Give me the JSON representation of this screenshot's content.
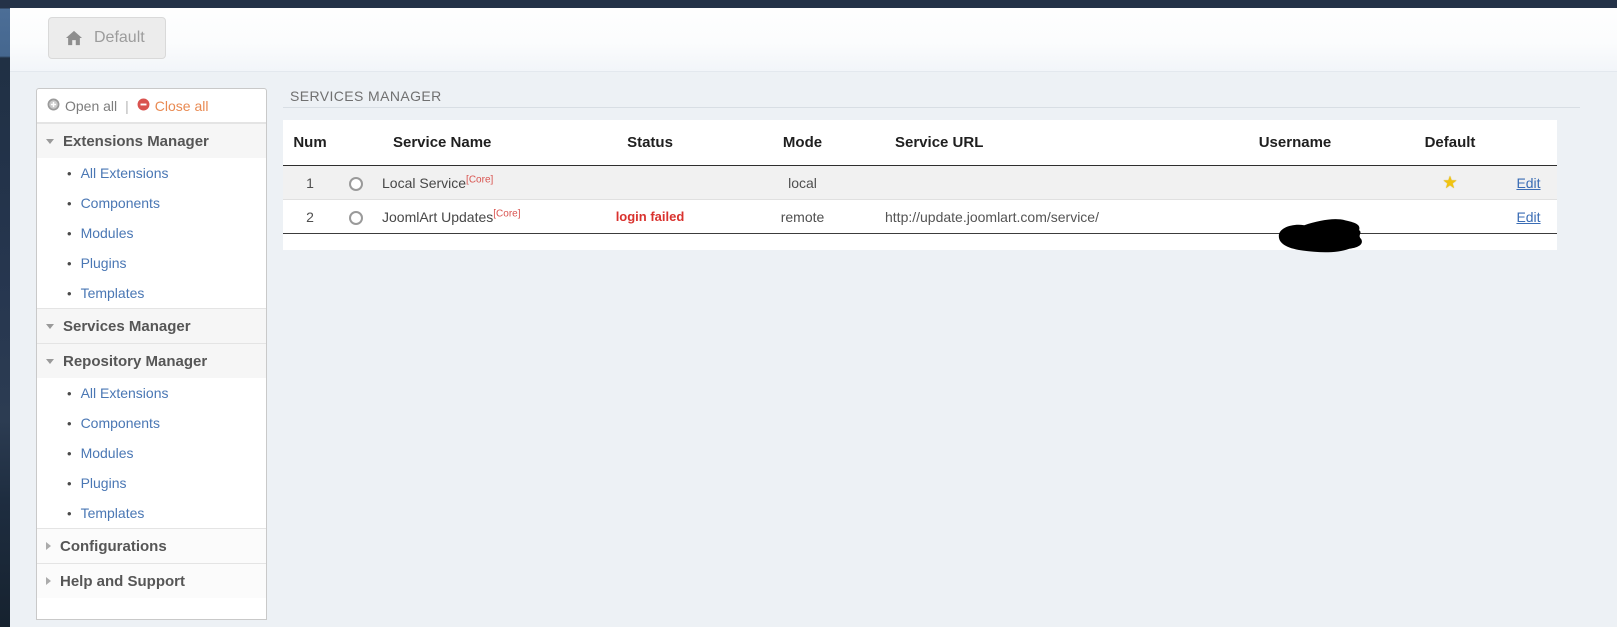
{
  "top_nav": {
    "default_label": "Default"
  },
  "sidebar": {
    "open_all": "Open all",
    "divider": "|",
    "close_all": "Close all",
    "sections": [
      {
        "label": "Extensions Manager",
        "state": "expanded",
        "items": [
          "All Extensions",
          "Components",
          "Modules",
          "Plugins",
          "Templates"
        ]
      },
      {
        "label": "Services Manager",
        "state": "expanded",
        "items": []
      },
      {
        "label": "Repository Manager",
        "state": "expanded",
        "items": [
          "All Extensions",
          "Components",
          "Modules",
          "Plugins",
          "Templates"
        ]
      },
      {
        "label": "Configurations",
        "state": "collapsed",
        "items": []
      },
      {
        "label": "Help and Support",
        "state": "collapsed",
        "items": []
      }
    ]
  },
  "main": {
    "title": "SERVICES MANAGER",
    "table": {
      "headers": {
        "num": "Num",
        "name": "Service Name",
        "status": "Status",
        "mode": "Mode",
        "url": "Service URL",
        "username": "Username",
        "default": "Default"
      },
      "star_glyph": "★",
      "rows": [
        {
          "num": "1",
          "name": "Local Service",
          "core": "[Core]",
          "status": "",
          "mode": "local",
          "url": "",
          "edit": "Edit"
        },
        {
          "num": "2",
          "name": "JoomlArt Updates",
          "core": "[Core]",
          "status": "login failed",
          "mode": "remote",
          "url": "http://update.joomlart.com/service/",
          "edit": "Edit"
        }
      ]
    }
  },
  "colors": {
    "topbar_navy": "#243248",
    "accent_blue_link": "#4a77b4",
    "status_red": "#d9322e",
    "core_red": "#d9534f",
    "close_all_orange": "#e98a52",
    "star_gold": "#f1c40f",
    "page_bg": "#edf1f5"
  }
}
